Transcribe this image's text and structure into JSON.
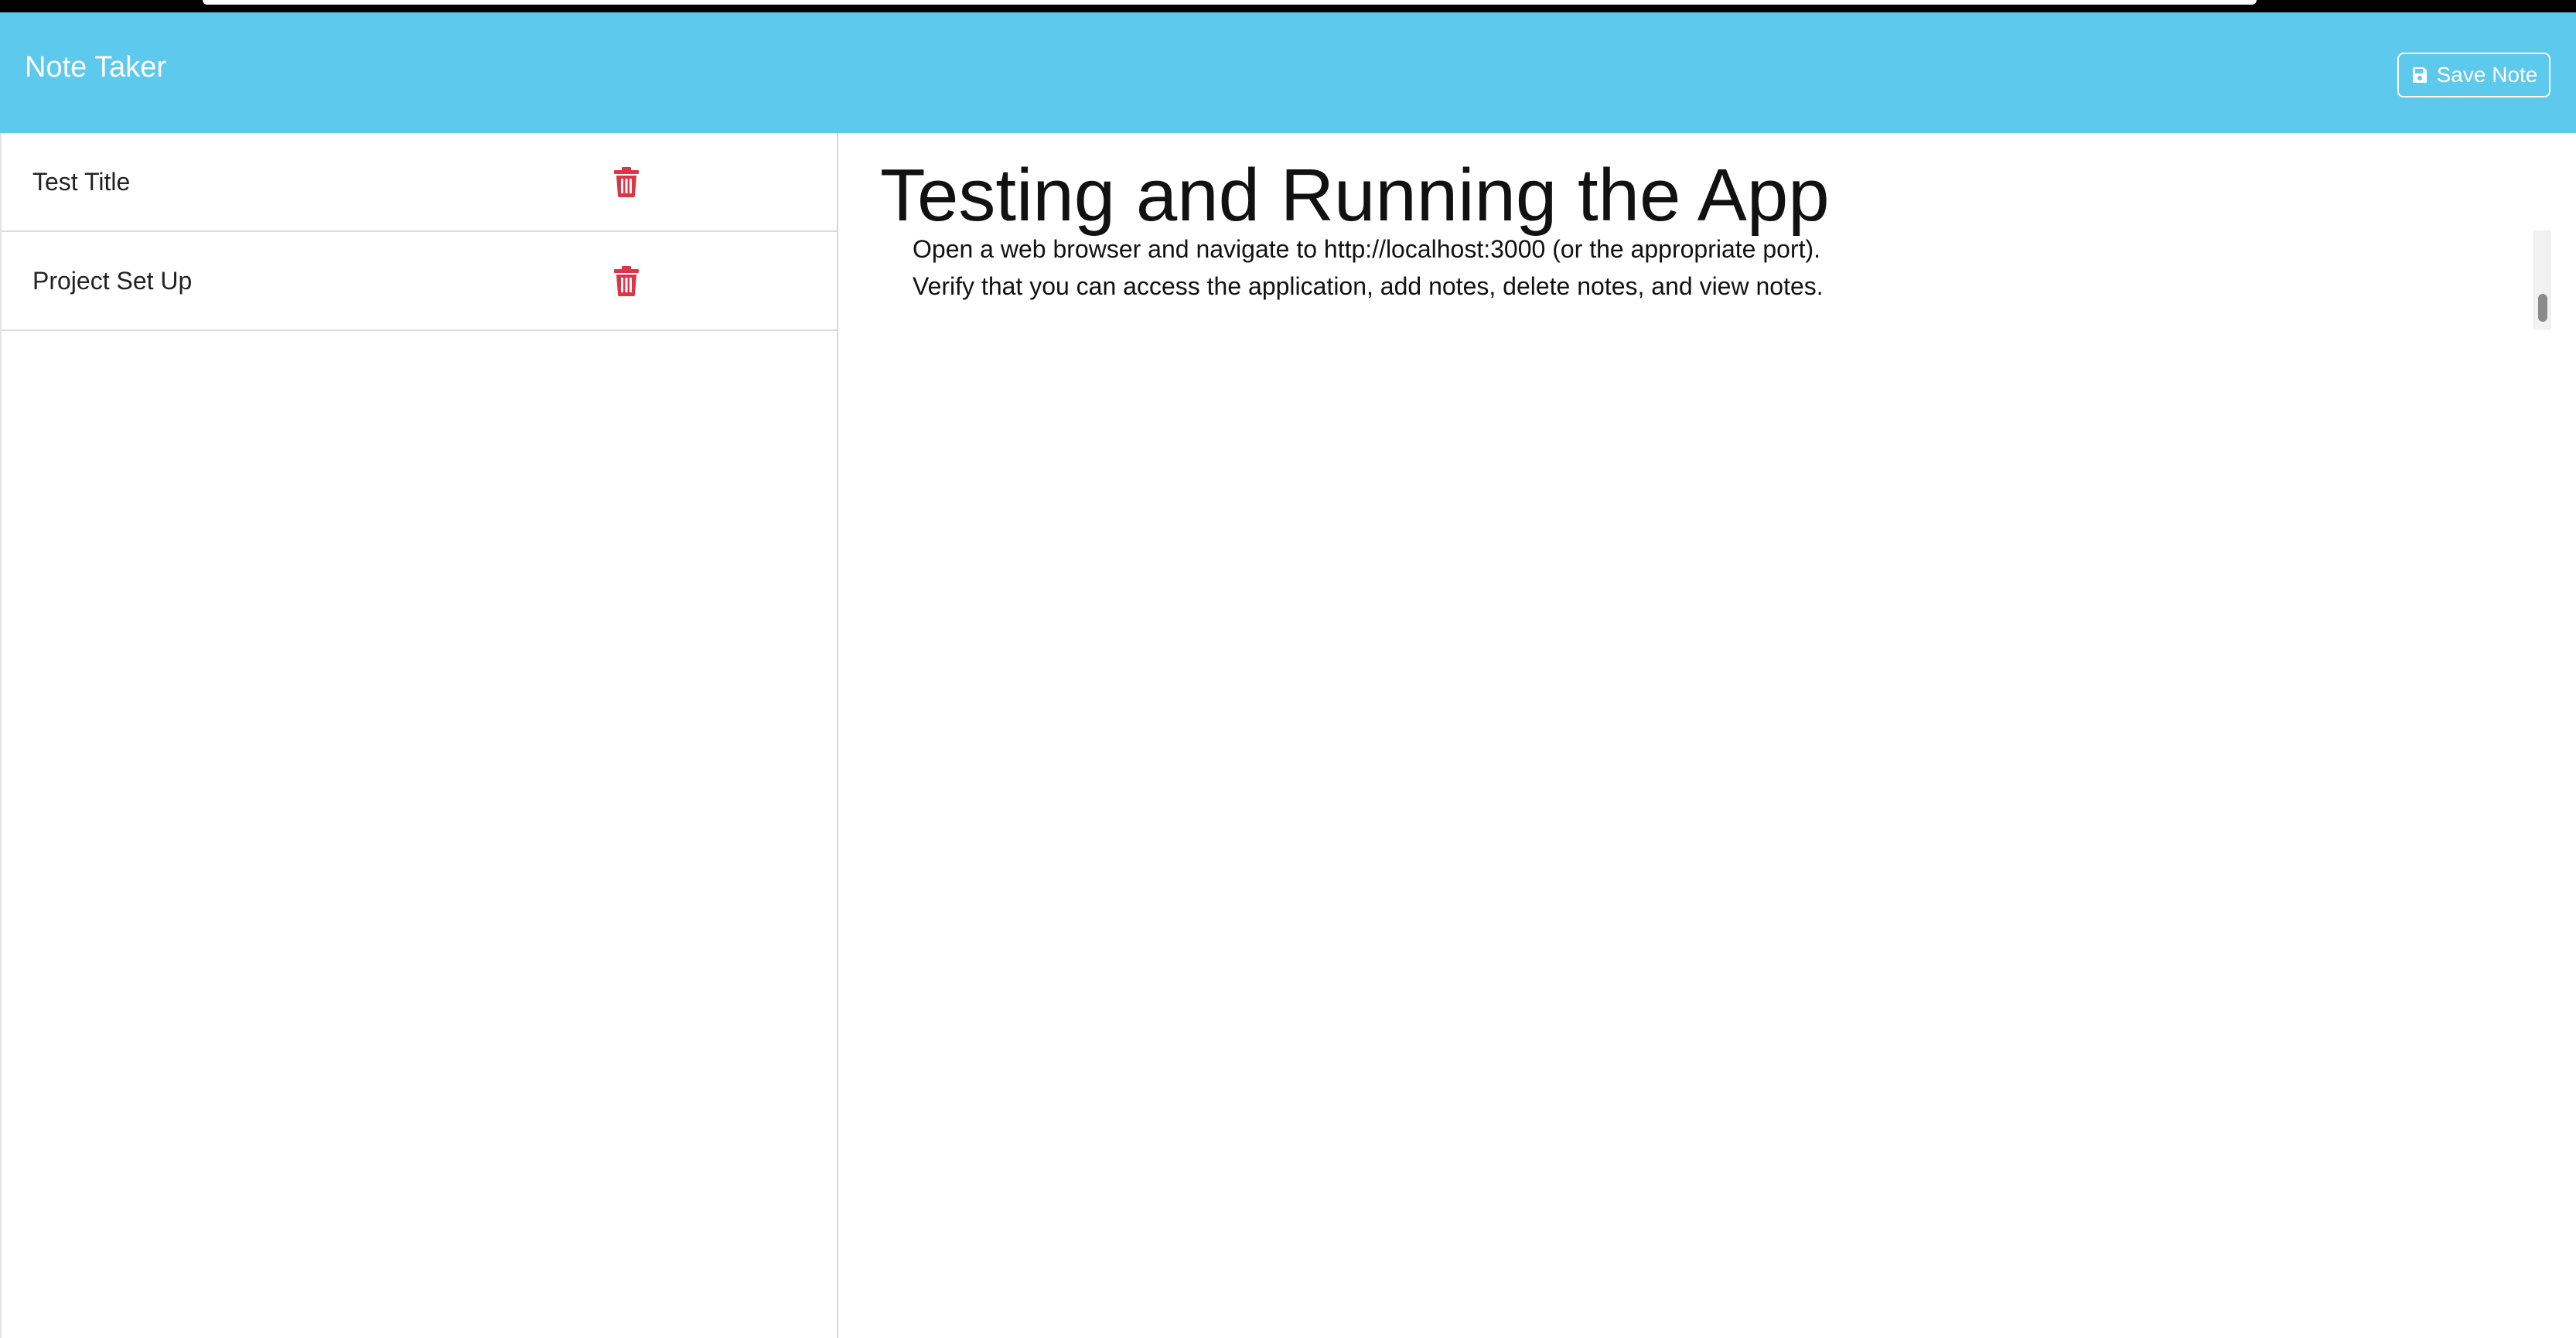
{
  "app": {
    "title": "Note Taker"
  },
  "toolbar": {
    "save_label": "Save Note",
    "save_icon": "floppy-disk-icon"
  },
  "sidebar": {
    "notes": [
      {
        "title": "Test Title",
        "delete_icon": "trash-icon"
      },
      {
        "title": "Project Set Up",
        "delete_icon": "trash-icon"
      }
    ]
  },
  "note": {
    "title": "Testing and Running the App",
    "text": "Open a web browser and navigate to http://localhost:3000 (or the appropriate port).\nVerify that you can access the application, add notes, delete notes, and view notes."
  },
  "colors": {
    "header": "#5dc9ed",
    "delete": "#dc3545",
    "header_text": "#ffffff"
  }
}
